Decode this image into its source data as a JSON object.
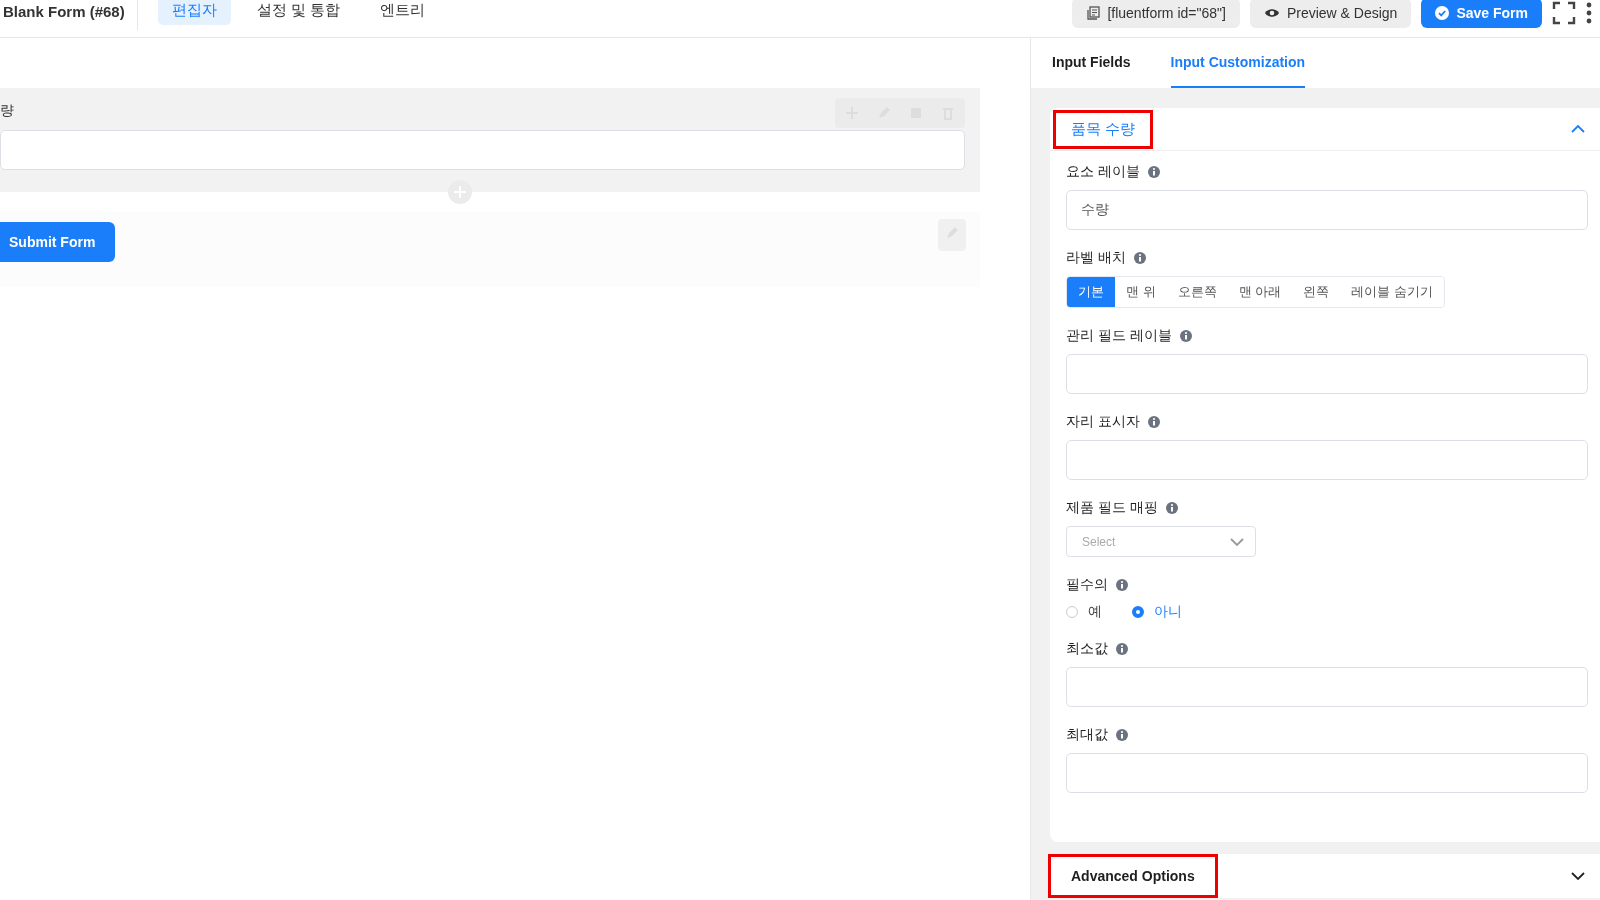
{
  "header": {
    "form_title": "Blank Form (#68)",
    "tabs": [
      {
        "label": "편집자",
        "selected": true
      },
      {
        "label": "설정 및 통합",
        "selected": false
      },
      {
        "label": "엔트리",
        "selected": false
      }
    ],
    "shortcode": "[fluentform id=\"68\"]",
    "preview_button": "Preview & Design",
    "save_button": "Save Form"
  },
  "canvas": {
    "field_label": "량",
    "submit_button": "Submit Form"
  },
  "panel": {
    "tabs": [
      {
        "label": "Input Fields",
        "selected": false
      },
      {
        "label": "Input Customization",
        "selected": true
      }
    ],
    "section": {
      "title": "품목 수량",
      "expanded": true,
      "highlighted": true
    },
    "settings": [
      {
        "kind": "text",
        "label": "요소 레이블",
        "value": "수량"
      },
      {
        "kind": "segmented",
        "label": "라벨 배치",
        "options": [
          {
            "label": "기본",
            "selected": true
          },
          {
            "label": "맨 위",
            "selected": false
          },
          {
            "label": "오른쪽",
            "selected": false
          },
          {
            "label": "맨 아래",
            "selected": false
          },
          {
            "label": "왼쪽",
            "selected": false
          },
          {
            "label": "레이블 숨기기",
            "selected": false
          }
        ]
      },
      {
        "kind": "text",
        "label": "관리 필드 레이블"
      },
      {
        "kind": "text",
        "label": "자리 표시자"
      },
      {
        "kind": "select",
        "label": "제품 필드 매핑",
        "placeholder": "Select"
      },
      {
        "kind": "radio",
        "label": "필수의",
        "options": [
          {
            "label": "예",
            "selected": false
          },
          {
            "label": "아니",
            "selected": true
          }
        ]
      },
      {
        "kind": "text",
        "label": "최소값"
      },
      {
        "kind": "text",
        "label": "최대값"
      }
    ],
    "advanced": {
      "title": "Advanced Options",
      "expanded": false,
      "highlighted": true
    }
  }
}
